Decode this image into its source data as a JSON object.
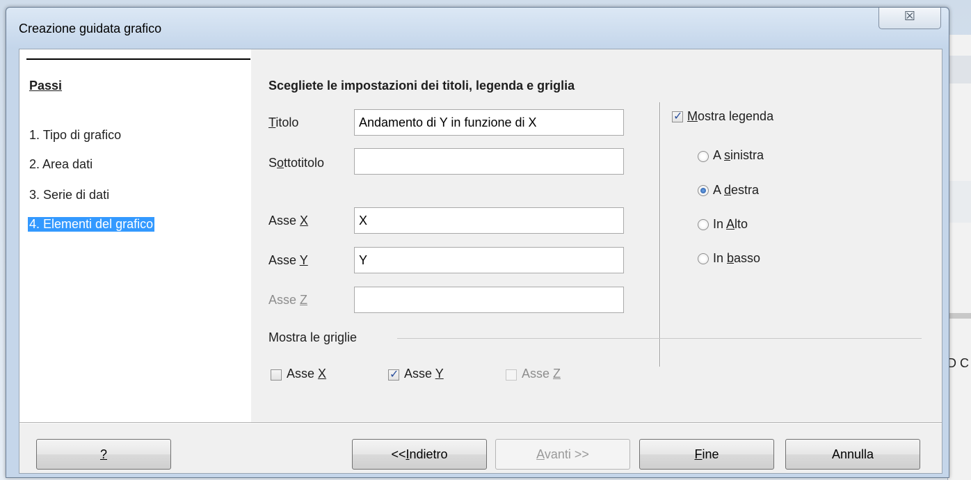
{
  "window": {
    "title": "Creazione guidata grafico",
    "close_glyph": "☒"
  },
  "sidebar": {
    "heading": "Passi",
    "steps": [
      {
        "label": "1. Tipo di grafico"
      },
      {
        "label": "2. Area dati"
      },
      {
        "label": "3. Serie di dati"
      },
      {
        "label": "4. Elementi del grafico",
        "selected": true
      }
    ]
  },
  "main": {
    "heading": "Scegliete le impostazioni dei titoli, legenda e griglia",
    "fields": {
      "titolo": {
        "label": "Titolo",
        "value": "Andamento di Y in funzione di X"
      },
      "sottotitolo": {
        "label": "Sottotitolo",
        "value": ""
      },
      "asse_x": {
        "label": "Asse X",
        "value": "X"
      },
      "asse_y": {
        "label": "Asse Y",
        "value": "Y"
      },
      "asse_z": {
        "label": "Asse Z",
        "value": "",
        "disabled": true
      }
    },
    "legend": {
      "show_label": "Mostra legenda",
      "show_checked": true,
      "positions": [
        {
          "label": "A sinistra",
          "selected": false
        },
        {
          "label": "A destra",
          "selected": true
        },
        {
          "label": "In Alto",
          "selected": false
        },
        {
          "label": "In basso",
          "selected": false
        }
      ]
    },
    "grids": {
      "label": "Mostra le griglie",
      "asse_x": {
        "label": "Asse X",
        "checked": false
      },
      "asse_y": {
        "label": "Asse Y",
        "checked": true
      },
      "asse_z": {
        "label": "Asse Z",
        "checked": false,
        "disabled": true
      }
    }
  },
  "buttons": {
    "help": "?",
    "back": "<<Indietro",
    "next": "Avanti >>",
    "finish": "Fine",
    "cancel": "Annulla"
  },
  "background": {
    "partial_text": "D C"
  },
  "colors": {
    "selection": "#3399ff",
    "dialog_bg": "#f0f0f0",
    "title_bar": "#c5d6ea"
  }
}
